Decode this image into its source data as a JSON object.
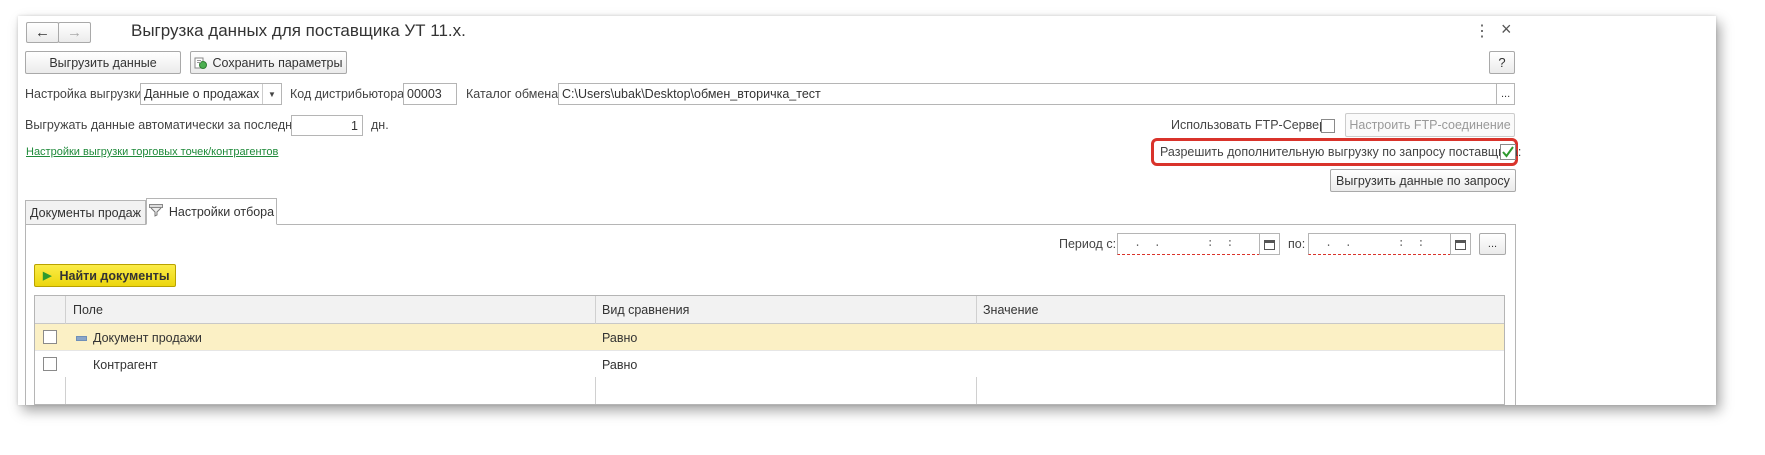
{
  "window": {
    "title": "Выгрузка данных для поставщика УТ 11.x.",
    "nav_back": "←",
    "nav_forward": "→",
    "more": "⋮",
    "close": "×"
  },
  "toolbar": {
    "export_button": "Выгрузить данные",
    "save_params_button": "Сохранить параметры",
    "help_button": "?"
  },
  "settings": {
    "export_setting_label": "Настройка выгрузки:",
    "export_setting_value": "Данные о продажах",
    "distributor_code_label": "Код дистрибьютора:",
    "distributor_code_value": "00003",
    "catalog_label": "Каталог обмена:",
    "catalog_value": "C:\\Users\\ubak\\Desktop\\обмен_вторичка_тест",
    "catalog_browse": "...",
    "auto_export_label": "Выгружать данные автоматически за последние:",
    "auto_export_value": "1",
    "auto_export_unit": "дн.",
    "outlets_link": "Настройки выгрузки торговых точек/контрагентов",
    "use_ftp_label": "Использовать FTP-Сервер:",
    "use_ftp_checked": false,
    "ftp_setup_button": "Настроить FTP-соединение",
    "allow_extra_label": "Разрешить дополнительную выгрузку по запросу поставщика:",
    "allow_extra_checked": true,
    "export_by_request_button": "Выгрузить данные по запросу"
  },
  "tabs": [
    {
      "label": "Документы продаж",
      "active": false
    },
    {
      "label": "Настройки отбора",
      "active": true
    }
  ],
  "filter": {
    "period_from_label": "Период с:",
    "period_from_value": "  .  .       :  :",
    "period_to_label": "по:",
    "period_to_value": "  .  .       :  :",
    "period_more": "...",
    "find_button": "Найти документы"
  },
  "table": {
    "columns": [
      "Поле",
      "Вид сравнения",
      "Значение"
    ],
    "rows": [
      {
        "field": "Документ продажи",
        "comparison": "Равно",
        "value": "",
        "checked": false,
        "selected": true
      },
      {
        "field": "Контрагент",
        "comparison": "Равно",
        "value": "",
        "checked": false,
        "selected": false
      }
    ]
  },
  "colors": {
    "highlight_border": "#d9332b",
    "link": "#1f8a3a",
    "find_button_bg": "#f5e11b",
    "selected_row_bg": "#fbf0c5",
    "checkmark": "#2e9a2e"
  }
}
